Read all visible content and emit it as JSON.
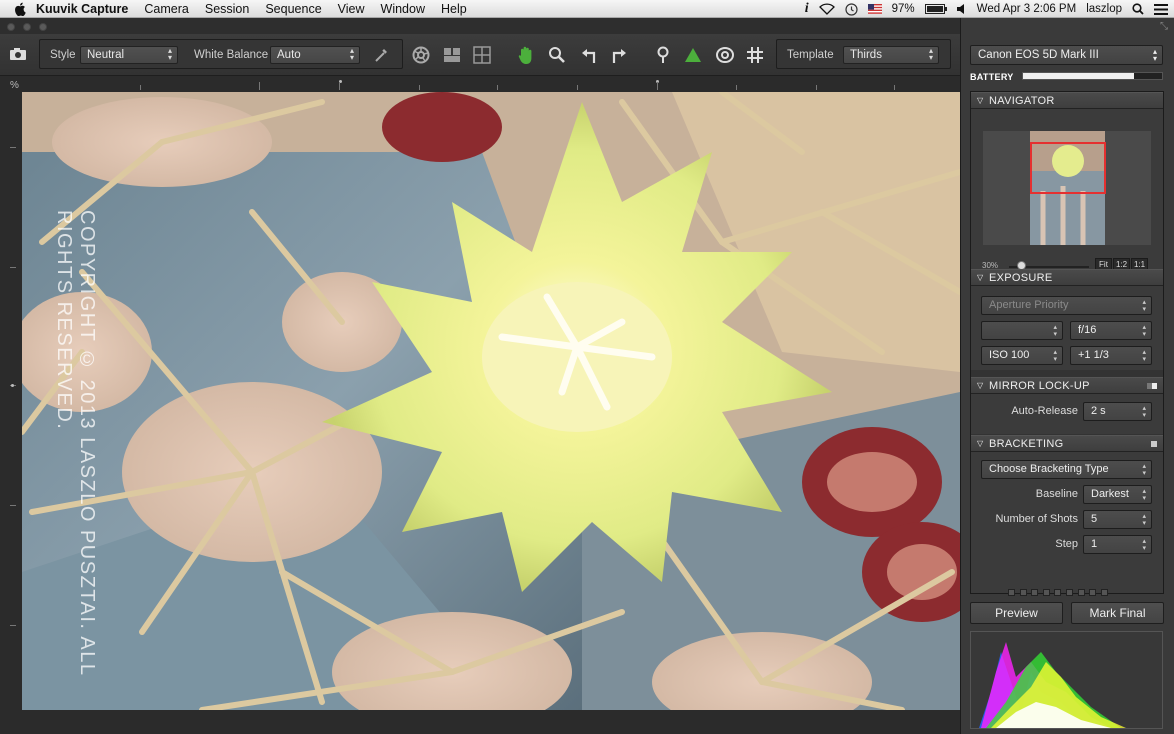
{
  "menubar": {
    "app": "Kuuvik Capture",
    "items": [
      "Camera",
      "Session",
      "Sequence",
      "View",
      "Window",
      "Help"
    ],
    "battery_pct": "97%",
    "clock": "Wed Apr 3  2:06 PM",
    "user": "laszlop",
    "icons": [
      "info-icon",
      "wifi-icon",
      "time-machine-icon",
      "flag-icon",
      "volume-icon",
      "search-icon",
      "list-icon"
    ]
  },
  "toolbar": {
    "style_label": "Style",
    "style_value": "Neutral",
    "wb_label": "White Balance",
    "wb_value": "Auto",
    "template_label": "Template",
    "template_value": "Thirds",
    "tools": [
      "camera-icon",
      "eyedropper-icon",
      "aperture-icon",
      "compare-icon",
      "grid-icon",
      "hand-icon",
      "zoom-icon",
      "rotate-left-icon",
      "rotate-right-icon",
      "pin-icon",
      "warning-icon",
      "focus-icon",
      "grid-overlay-icon"
    ]
  },
  "ruler": {
    "unit": "%"
  },
  "image": {
    "copyright": "COPYRIGHT © 2013 LASZLO PUSZTAI. ALL RIGHTS RESERVED."
  },
  "sidebar": {
    "camera": "Canon EOS 5D Mark III",
    "battery_label": "BATTERY",
    "battery_level": 0.8,
    "navigator": {
      "title": "NAVIGATOR",
      "zoom": "30%",
      "zoom_level": 0.15,
      "fit": "Fit",
      "one_two": "1:2",
      "one_one": "1:1"
    },
    "exposure": {
      "title": "EXPOSURE",
      "mode": "Aperture Priority",
      "shutter": "",
      "aperture": "f/16",
      "iso": "ISO 100",
      "compensation": "+1 1/3"
    },
    "mirror": {
      "title": "MIRROR LOCK-UP",
      "auto_release_label": "Auto-Release",
      "auto_release_value": "2 s"
    },
    "bracketing": {
      "title": "BRACKETING",
      "type_placeholder": "Choose Bracketing Type",
      "baseline_label": "Baseline",
      "baseline_value": "Darkest",
      "shots_label": "Number of Shots",
      "shots_value": "5",
      "step_label": "Step",
      "step_value": "1"
    },
    "buttons": {
      "preview": "Preview",
      "mark_final": "Mark Final"
    }
  }
}
